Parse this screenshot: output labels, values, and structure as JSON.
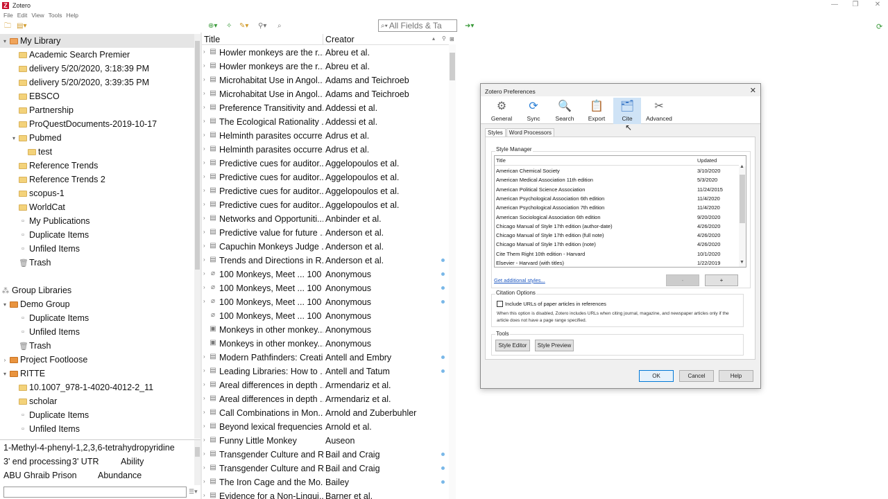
{
  "window": {
    "title": "Zotero",
    "logo_letter": "Z"
  },
  "menu": [
    "File",
    "Edit",
    "View",
    "Tools",
    "Help"
  ],
  "toolbar": {
    "search_placeholder": "All Fields & Ta"
  },
  "collections": [
    {
      "label": "My Library",
      "level": 0,
      "twisty": "v",
      "icon": "library",
      "selected": true
    },
    {
      "label": "Academic Search Premier",
      "level": 1,
      "icon": "folder"
    },
    {
      "label": "delivery 5/20/2020, 3:18:39 PM",
      "level": 1,
      "icon": "folder"
    },
    {
      "label": "delivery 5/20/2020, 3:39:35 PM",
      "level": 1,
      "icon": "folder"
    },
    {
      "label": "EBSCO",
      "level": 1,
      "icon": "folder"
    },
    {
      "label": "Partnership",
      "level": 1,
      "icon": "folder"
    },
    {
      "label": "ProQuestDocuments-2019-10-17",
      "level": 1,
      "icon": "folder"
    },
    {
      "label": "Pubmed",
      "level": 1,
      "twisty": "v",
      "icon": "folder"
    },
    {
      "label": "test",
      "level": 2,
      "icon": "folder"
    },
    {
      "label": "Reference Trends",
      "level": 1,
      "icon": "folder"
    },
    {
      "label": "Reference Trends 2",
      "level": 1,
      "icon": "folder"
    },
    {
      "label": "scopus-1",
      "level": 1,
      "icon": "folder"
    },
    {
      "label": "WorldCat",
      "level": 1,
      "icon": "folder"
    },
    {
      "label": "My Publications",
      "level": 1,
      "icon": "doc"
    },
    {
      "label": "Duplicate Items",
      "level": 1,
      "icon": "doc"
    },
    {
      "label": "Unfiled Items",
      "level": 1,
      "icon": "doc"
    },
    {
      "label": "Trash",
      "level": 1,
      "icon": "trash"
    },
    {
      "label": "",
      "level": 0,
      "icon": "none"
    },
    {
      "label": "Group Libraries",
      "level": 0,
      "icon": "group-header"
    },
    {
      "label": "Demo Group",
      "level": 0,
      "twisty": "v",
      "icon": "group"
    },
    {
      "label": "Duplicate Items",
      "level": 1,
      "icon": "doc"
    },
    {
      "label": "Unfiled Items",
      "level": 1,
      "icon": "doc"
    },
    {
      "label": "Trash",
      "level": 1,
      "icon": "trash"
    },
    {
      "label": "Project Footloose",
      "level": 0,
      "twisty": ">",
      "icon": "group"
    },
    {
      "label": "RITTE",
      "level": 0,
      "twisty": "v",
      "icon": "group"
    },
    {
      "label": "10.1007_978-1-4020-4012-2_11",
      "level": 1,
      "icon": "folder"
    },
    {
      "label": "scholar",
      "level": 1,
      "icon": "folder"
    },
    {
      "label": "Duplicate Items",
      "level": 1,
      "icon": "doc"
    },
    {
      "label": "Unfiled Items",
      "level": 1,
      "icon": "doc"
    }
  ],
  "tags": [
    {
      "label": "1-Methyl-4-phenyl-1,2,3,6-tetrahydropyridine",
      "row": 0,
      "col": 0
    },
    {
      "label": "3' end processing",
      "row": 1,
      "col": 0
    },
    {
      "label": "3' UTR",
      "row": 1,
      "col": 1
    },
    {
      "label": "Ability",
      "row": 1,
      "col": 2
    },
    {
      "label": "ABU Ghraib Prison",
      "row": 2,
      "col": 0
    },
    {
      "label": "Abundance",
      "row": 2,
      "col": 1
    }
  ],
  "items_header": {
    "title": "Title",
    "creator": "Creator"
  },
  "items": [
    {
      "title": "Howler monkeys are the r...",
      "creator": "Abreu et al.",
      "twisty": true,
      "icon": "doc",
      "dot": false
    },
    {
      "title": "Howler monkeys are the r...",
      "creator": "Abreu et al.",
      "twisty": true,
      "icon": "doc",
      "dot": false
    },
    {
      "title": "Microhabitat Use in Angol...",
      "creator": "Adams and Teichroeb",
      "twisty": true,
      "icon": "doc",
      "dot": false
    },
    {
      "title": "Microhabitat Use in Angol...",
      "creator": "Adams and Teichroeb",
      "twisty": true,
      "icon": "doc",
      "dot": false
    },
    {
      "title": "Preference Transitivity and...",
      "creator": "Addessi et al.",
      "twisty": true,
      "icon": "doc",
      "dot": false
    },
    {
      "title": "The Ecological Rationality ...",
      "creator": "Addessi et al.",
      "twisty": true,
      "icon": "doc",
      "dot": false
    },
    {
      "title": "Helminth parasites occurre...",
      "creator": "Adrus et al.",
      "twisty": true,
      "icon": "doc",
      "dot": false
    },
    {
      "title": "Helminth parasites occurre...",
      "creator": "Adrus et al.",
      "twisty": true,
      "icon": "doc",
      "dot": false
    },
    {
      "title": "Predictive cues for auditor...",
      "creator": "Aggelopoulos et al.",
      "twisty": true,
      "icon": "doc",
      "dot": false
    },
    {
      "title": "Predictive cues for auditor...",
      "creator": "Aggelopoulos et al.",
      "twisty": true,
      "icon": "doc",
      "dot": false
    },
    {
      "title": "Predictive cues for auditor...",
      "creator": "Aggelopoulos et al.",
      "twisty": true,
      "icon": "doc",
      "dot": false
    },
    {
      "title": "Predictive cues for auditor...",
      "creator": "Aggelopoulos et al.",
      "twisty": true,
      "icon": "doc",
      "dot": false
    },
    {
      "title": "Networks and Opportuniti...",
      "creator": "Anbinder et al.",
      "twisty": true,
      "icon": "doc",
      "dot": false
    },
    {
      "title": "Predictive value for future ...",
      "creator": "Anderson et al.",
      "twisty": true,
      "icon": "doc",
      "dot": false
    },
    {
      "title": "Capuchin Monkeys Judge ...",
      "creator": "Anderson et al.",
      "twisty": true,
      "icon": "doc",
      "dot": false
    },
    {
      "title": "Trends and Directions in R...",
      "creator": "Anderson et al.",
      "twisty": true,
      "icon": "doc",
      "dot": true
    },
    {
      "title": "100 Monkeys, Meet ... 100 ...",
      "creator": "Anonymous",
      "twisty": true,
      "icon": "link",
      "dot": true
    },
    {
      "title": "100 Monkeys, Meet ... 100 ...",
      "creator": "Anonymous",
      "twisty": true,
      "icon": "link",
      "dot": true
    },
    {
      "title": "100 Monkeys, Meet ... 100 ...",
      "creator": "Anonymous",
      "twisty": true,
      "icon": "link",
      "dot": true
    },
    {
      "title": "100 Monkeys, Meet ... 100 ...",
      "creator": "Anonymous",
      "twisty": false,
      "icon": "link",
      "dot": false
    },
    {
      "title": "Monkeys in other monkey...",
      "creator": "Anonymous",
      "twisty": false,
      "icon": "image",
      "dot": false
    },
    {
      "title": "Monkeys in other monkey...",
      "creator": "Anonymous",
      "twisty": false,
      "icon": "image",
      "dot": false
    },
    {
      "title": "Modern Pathfinders: Creati...",
      "creator": "Antell and Embry",
      "twisty": true,
      "icon": "doc",
      "dot": true
    },
    {
      "title": "Leading Libraries: How to ...",
      "creator": "Antell and Tatum",
      "twisty": true,
      "icon": "doc",
      "dot": true
    },
    {
      "title": "Areal differences in depth ...",
      "creator": "Armendariz et al.",
      "twisty": true,
      "icon": "doc",
      "dot": false
    },
    {
      "title": "Areal differences in depth ...",
      "creator": "Armendariz et al.",
      "twisty": true,
      "icon": "doc",
      "dot": false
    },
    {
      "title": "Call Combinations in Mon...",
      "creator": "Arnold and Zuberbuhler",
      "twisty": true,
      "icon": "doc",
      "dot": false
    },
    {
      "title": "Beyond lexical frequencies...",
      "creator": "Arnold et al.",
      "twisty": true,
      "icon": "doc",
      "dot": false
    },
    {
      "title": "Funny Little Monkey",
      "creator": "Auseon",
      "twisty": true,
      "icon": "doc",
      "dot": false
    },
    {
      "title": "Transgender Culture and R...",
      "creator": "Bail and Craig",
      "twisty": true,
      "icon": "doc",
      "dot": true
    },
    {
      "title": "Transgender Culture and R...",
      "creator": "Bail and Craig",
      "twisty": true,
      "icon": "doc",
      "dot": true
    },
    {
      "title": "The Iron Cage and the Mo...",
      "creator": "Bailey",
      "twisty": true,
      "icon": "doc",
      "dot": true
    },
    {
      "title": "Evidence for a Non-Lingui...",
      "creator": "Barner et al.",
      "twisty": true,
      "icon": "doc",
      "dot": false
    }
  ],
  "prefs": {
    "title": "Zotero Preferences",
    "panes": [
      {
        "label": "General",
        "icon": "gear-icon",
        "active": false
      },
      {
        "label": "Sync",
        "icon": "sync-icon",
        "active": false
      },
      {
        "label": "Search",
        "icon": "search-doc-icon",
        "active": false
      },
      {
        "label": "Export",
        "icon": "clipboard-icon",
        "active": false
      },
      {
        "label": "Cite",
        "icon": "folder-icon",
        "active": true
      },
      {
        "label": "Advanced",
        "icon": "tools-icon",
        "active": false
      }
    ],
    "subtabs": [
      {
        "label": "Styles",
        "active": true
      },
      {
        "label": "Word Processors",
        "active": false
      }
    ],
    "style_manager": {
      "label": "Style Manager",
      "col_title": "Title",
      "col_updated": "Updated",
      "rows": [
        {
          "title": "American Chemical Society",
          "updated": "3/10/2020"
        },
        {
          "title": "American Medical Association 11th edition",
          "updated": "5/3/2020"
        },
        {
          "title": "American Political Science Association",
          "updated": "11/24/2015"
        },
        {
          "title": "American Psychological Association 6th edition",
          "updated": "11/4/2020"
        },
        {
          "title": "American Psychological Association 7th edition",
          "updated": "11/4/2020"
        },
        {
          "title": "American Sociological Association 6th edition",
          "updated": "9/20/2020"
        },
        {
          "title": "Chicago Manual of Style 17th edition (author-date)",
          "updated": "4/26/2020"
        },
        {
          "title": "Chicago Manual of Style 17th edition (full note)",
          "updated": "4/26/2020"
        },
        {
          "title": "Chicago Manual of Style 17th edition (note)",
          "updated": "4/26/2020"
        },
        {
          "title": "Cite Them Right 10th edition - Harvard",
          "updated": "10/1/2020"
        },
        {
          "title": "Elsevier - Harvard (with titles)",
          "updated": "1/22/2019"
        }
      ],
      "get_more": "Get additional styles...",
      "remove": "-",
      "add": "+"
    },
    "citation_options": {
      "label": "Citation Options",
      "include_urls": "Include URLs of paper articles in references",
      "note": "When this option is disabled, Zotero includes URLs when citing journal, magazine, and newspaper articles only if the article does not have a page range specified."
    },
    "tools": {
      "label": "Tools",
      "style_editor": "Style Editor",
      "style_preview": "Style Preview"
    },
    "buttons": {
      "ok": "OK",
      "cancel": "Cancel",
      "help": "Help"
    }
  },
  "colors": {
    "accent": "#0078d7",
    "selection": "#cfe3f6",
    "folder": "#f3d27a"
  }
}
